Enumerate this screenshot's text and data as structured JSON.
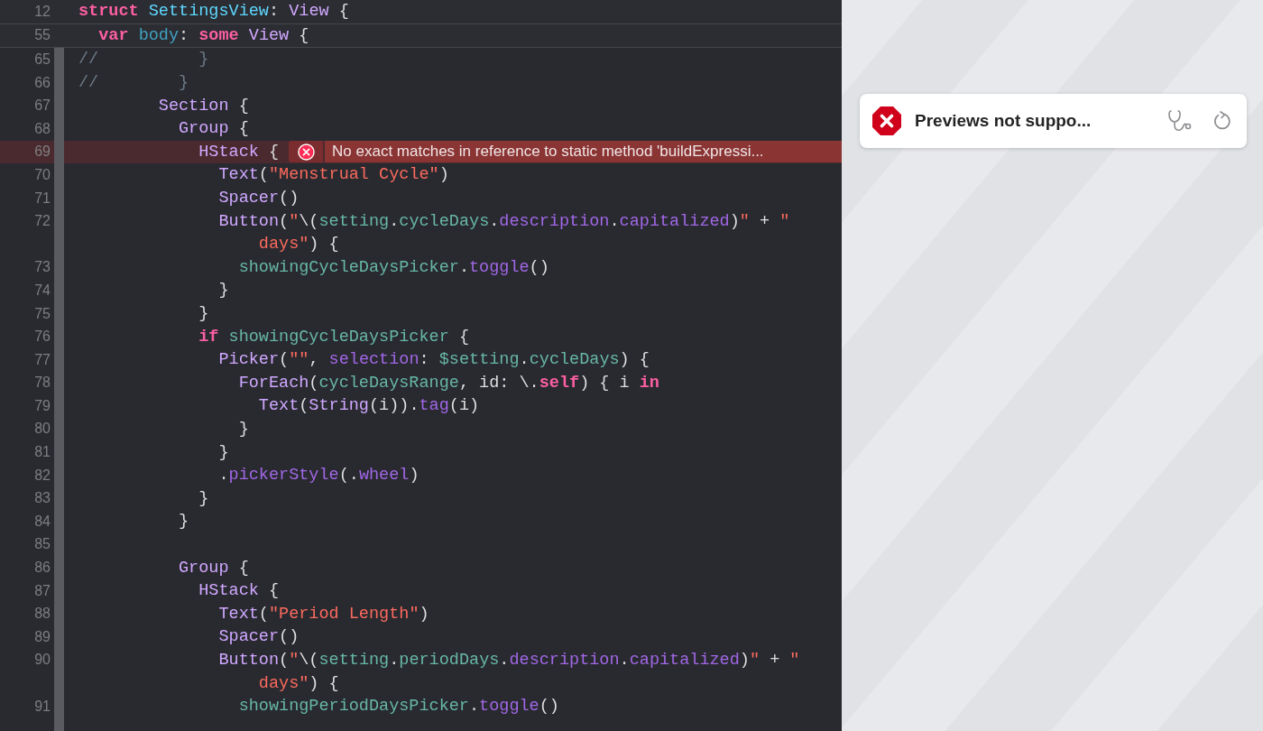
{
  "editor": {
    "sticky_lines": [
      {
        "number": "12",
        "tokens": [
          {
            "kind": "keyword",
            "text": "struct "
          },
          {
            "kind": "decl",
            "text": "SettingsView"
          },
          {
            "kind": "plain",
            "text": ": "
          },
          {
            "kind": "type",
            "text": "View"
          },
          {
            "kind": "plain",
            "text": " {"
          }
        ]
      },
      {
        "number": "55",
        "tokens": [
          {
            "kind": "keyword",
            "text": "  var "
          },
          {
            "kind": "property",
            "text": "body"
          },
          {
            "kind": "plain",
            "text": ": "
          },
          {
            "kind": "keyword",
            "text": "some "
          },
          {
            "kind": "type",
            "text": "View"
          },
          {
            "kind": "plain",
            "text": " {"
          }
        ]
      }
    ],
    "lines": [
      {
        "number": "65",
        "tokens": [
          {
            "kind": "comment",
            "text": "//          }"
          }
        ]
      },
      {
        "number": "66",
        "tokens": [
          {
            "kind": "comment",
            "text": "//        }"
          }
        ]
      },
      {
        "number": "67",
        "tokens": [
          {
            "kind": "type",
            "text": "        Section"
          },
          {
            "kind": "plain",
            "text": " {"
          }
        ]
      },
      {
        "number": "68",
        "tokens": [
          {
            "kind": "type",
            "text": "          Group"
          },
          {
            "kind": "plain",
            "text": " {"
          }
        ]
      },
      {
        "number": "69",
        "tokens": [
          {
            "kind": "type",
            "text": "            HStack"
          },
          {
            "kind": "plain",
            "text": " {"
          }
        ],
        "error": "No exact matches in reference to static method 'buildExpressi..."
      },
      {
        "number": "70",
        "tokens": [
          {
            "kind": "type",
            "text": "              Text"
          },
          {
            "kind": "plain",
            "text": "("
          },
          {
            "kind": "string",
            "text": "\"Menstrual Cycle\""
          },
          {
            "kind": "plain",
            "text": ")"
          }
        ]
      },
      {
        "number": "71",
        "tokens": [
          {
            "kind": "type",
            "text": "              Spacer"
          },
          {
            "kind": "plain",
            "text": "()"
          }
        ]
      },
      {
        "number": "72",
        "tokens": [
          {
            "kind": "type",
            "text": "              Button"
          },
          {
            "kind": "plain",
            "text": "("
          },
          {
            "kind": "string",
            "text": "\""
          },
          {
            "kind": "plain",
            "text": "\\("
          },
          {
            "kind": "ident",
            "text": "setting"
          },
          {
            "kind": "plain",
            "text": "."
          },
          {
            "kind": "ident",
            "text": "cycleDays"
          },
          {
            "kind": "plain",
            "text": "."
          },
          {
            "kind": "member",
            "text": "description"
          },
          {
            "kind": "plain",
            "text": "."
          },
          {
            "kind": "member",
            "text": "capitalized"
          },
          {
            "kind": "plain",
            "text": ")"
          },
          {
            "kind": "string",
            "text": "\""
          },
          {
            "kind": "plain",
            "text": " + "
          },
          {
            "kind": "string",
            "text": "\""
          }
        ]
      },
      {
        "tokens": [
          {
            "kind": "string",
            "text": "                  days\""
          },
          {
            "kind": "plain",
            "text": ") {"
          }
        ]
      },
      {
        "number": "73",
        "tokens": [
          {
            "kind": "ident",
            "text": "                showingCycleDaysPicker"
          },
          {
            "kind": "plain",
            "text": "."
          },
          {
            "kind": "member",
            "text": "toggle"
          },
          {
            "kind": "plain",
            "text": "()"
          }
        ]
      },
      {
        "number": "74",
        "tokens": [
          {
            "kind": "plain",
            "text": "              }"
          }
        ]
      },
      {
        "number": "75",
        "tokens": [
          {
            "kind": "plain",
            "text": "            }"
          }
        ]
      },
      {
        "number": "76",
        "tokens": [
          {
            "kind": "keyword",
            "text": "            if "
          },
          {
            "kind": "ident",
            "text": "showingCycleDaysPicker"
          },
          {
            "kind": "plain",
            "text": " {"
          }
        ]
      },
      {
        "number": "77",
        "tokens": [
          {
            "kind": "type",
            "text": "              Picker"
          },
          {
            "kind": "plain",
            "text": "("
          },
          {
            "kind": "string",
            "text": "\"\""
          },
          {
            "kind": "plain",
            "text": ", "
          },
          {
            "kind": "member",
            "text": "selection"
          },
          {
            "kind": "plain",
            "text": ": "
          },
          {
            "kind": "ident",
            "text": "$setting"
          },
          {
            "kind": "plain",
            "text": "."
          },
          {
            "kind": "ident",
            "text": "cycleDays"
          },
          {
            "kind": "plain",
            "text": ") {"
          }
        ]
      },
      {
        "number": "78",
        "tokens": [
          {
            "kind": "type",
            "text": "                ForEach"
          },
          {
            "kind": "plain",
            "text": "("
          },
          {
            "kind": "ident",
            "text": "cycleDaysRange"
          },
          {
            "kind": "plain",
            "text": ", id: \\."
          },
          {
            "kind": "keyword",
            "text": "self"
          },
          {
            "kind": "plain",
            "text": ") { i "
          },
          {
            "kind": "keyword",
            "text": "in"
          }
        ]
      },
      {
        "number": "79",
        "tokens": [
          {
            "kind": "type",
            "text": "                  Text"
          },
          {
            "kind": "plain",
            "text": "("
          },
          {
            "kind": "type",
            "text": "String"
          },
          {
            "kind": "plain",
            "text": "(i))."
          },
          {
            "kind": "member",
            "text": "tag"
          },
          {
            "kind": "plain",
            "text": "(i)"
          }
        ]
      },
      {
        "number": "80",
        "tokens": [
          {
            "kind": "plain",
            "text": "                }"
          }
        ]
      },
      {
        "number": "81",
        "tokens": [
          {
            "kind": "plain",
            "text": "              }"
          }
        ]
      },
      {
        "number": "82",
        "tokens": [
          {
            "kind": "plain",
            "text": "              ."
          },
          {
            "kind": "member",
            "text": "pickerStyle"
          },
          {
            "kind": "plain",
            "text": "(."
          },
          {
            "kind": "member",
            "text": "wheel"
          },
          {
            "kind": "plain",
            "text": ")"
          }
        ]
      },
      {
        "number": "83",
        "tokens": [
          {
            "kind": "plain",
            "text": "            }"
          }
        ]
      },
      {
        "number": "84",
        "tokens": [
          {
            "kind": "plain",
            "text": "          }"
          }
        ]
      },
      {
        "number": "85"
      },
      {
        "number": "86",
        "tokens": [
          {
            "kind": "type",
            "text": "          Group"
          },
          {
            "kind": "plain",
            "text": " {"
          }
        ]
      },
      {
        "number": "87",
        "tokens": [
          {
            "kind": "type",
            "text": "            HStack"
          },
          {
            "kind": "plain",
            "text": " {"
          }
        ]
      },
      {
        "number": "88",
        "tokens": [
          {
            "kind": "type",
            "text": "              Text"
          },
          {
            "kind": "plain",
            "text": "("
          },
          {
            "kind": "string",
            "text": "\"Period Length\""
          },
          {
            "kind": "plain",
            "text": ")"
          }
        ]
      },
      {
        "number": "89",
        "tokens": [
          {
            "kind": "type",
            "text": "              Spacer"
          },
          {
            "kind": "plain",
            "text": "()"
          }
        ]
      },
      {
        "number": "90",
        "tokens": [
          {
            "kind": "type",
            "text": "              Button"
          },
          {
            "kind": "plain",
            "text": "("
          },
          {
            "kind": "string",
            "text": "\""
          },
          {
            "kind": "plain",
            "text": "\\("
          },
          {
            "kind": "ident",
            "text": "setting"
          },
          {
            "kind": "plain",
            "text": "."
          },
          {
            "kind": "ident",
            "text": "periodDays"
          },
          {
            "kind": "plain",
            "text": "."
          },
          {
            "kind": "member",
            "text": "description"
          },
          {
            "kind": "plain",
            "text": "."
          },
          {
            "kind": "member",
            "text": "capitalized"
          },
          {
            "kind": "plain",
            "text": ")"
          },
          {
            "kind": "string",
            "text": "\""
          },
          {
            "kind": "plain",
            "text": " + "
          },
          {
            "kind": "string",
            "text": "\""
          }
        ]
      },
      {
        "tokens": [
          {
            "kind": "string",
            "text": "                  days\""
          },
          {
            "kind": "plain",
            "text": ") {"
          }
        ]
      },
      {
        "number": "91",
        "tokens": [
          {
            "kind": "ident",
            "text": "                showingPeriodDaysPicker"
          },
          {
            "kind": "plain",
            "text": "."
          },
          {
            "kind": "member",
            "text": "toggle"
          },
          {
            "kind": "plain",
            "text": "()"
          }
        ]
      }
    ]
  },
  "preview": {
    "status": {
      "title": "Previews not suppo..."
    }
  }
}
